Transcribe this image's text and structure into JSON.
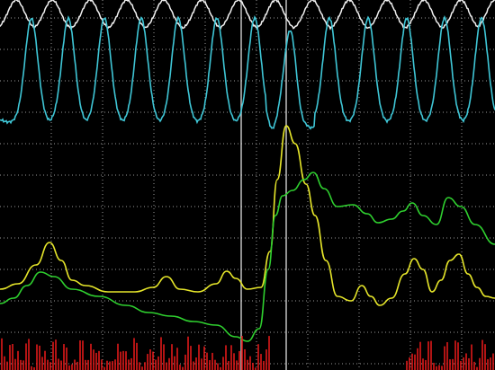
{
  "display": {
    "background_color": "#000000",
    "grid_color": "#9a9a9a",
    "grid_style": "dotted",
    "cursor_color": "#cfcfcf",
    "cursor_count": 2
  },
  "traces": [
    {
      "id": "trace-1",
      "color": "#f2f2f2",
      "shape": "periodic-peaks"
    },
    {
      "id": "trace-2",
      "color": "#3fc6d6",
      "shape": "periodic-peaks"
    },
    {
      "id": "trace-3",
      "color": "#e6e62a",
      "shape": "smooth-curve"
    },
    {
      "id": "trace-4",
      "color": "#2fd02f",
      "shape": "step-rise"
    },
    {
      "id": "trace-5",
      "color": "#e01a1a",
      "shape": "spike-bars"
    }
  ]
}
